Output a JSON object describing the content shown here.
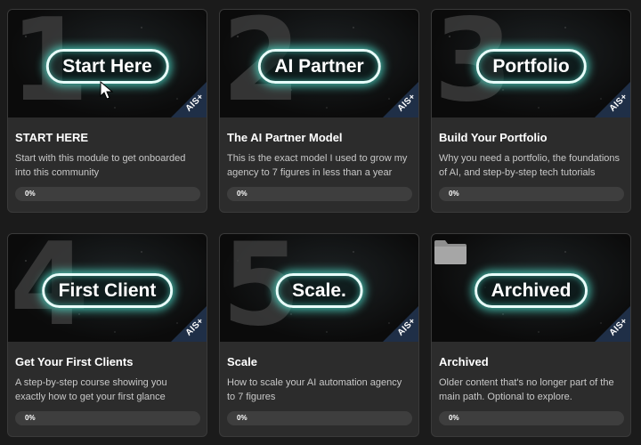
{
  "courses": [
    {
      "thumb_number": "1",
      "thumb_label": "Start Here",
      "badge": "AIS+",
      "title": "START HERE",
      "description": "Start with this module to get onboarded into this community",
      "progress_label": "0%",
      "progress": 0
    },
    {
      "thumb_number": "2",
      "thumb_label": "AI Partner",
      "badge": "AIS+",
      "title": "The AI Partner Model",
      "description": "This is the exact model I used to grow my agency to 7 figures in less than a year",
      "progress_label": "0%",
      "progress": 0
    },
    {
      "thumb_number": "3",
      "thumb_label": "Portfolio",
      "badge": "AIS+",
      "title": "Build Your Portfolio",
      "description": "Why you need a portfolio, the foundations of AI, and step-by-step tech tutorials",
      "progress_label": "0%",
      "progress": 0
    },
    {
      "thumb_number": "4",
      "thumb_label": "First Client",
      "badge": "AIS+",
      "title": "Get Your First Clients",
      "description": "A step-by-step course showing you exactly how to get your first glance",
      "progress_label": "0%",
      "progress": 0
    },
    {
      "thumb_number": "5",
      "thumb_label": "Scale.",
      "badge": "AIS+",
      "title": "Scale",
      "description": "How to scale your AI automation agency to 7 figures",
      "progress_label": "0%",
      "progress": 0
    },
    {
      "thumb_number": "",
      "thumb_label": "Archived",
      "badge": "AIS+",
      "title": "Archived",
      "description": "Older content that's no longer part of the main path. Optional to explore.",
      "progress_label": "0%",
      "progress": 0
    }
  ],
  "icons": {
    "cursor": "mouse-pointer-icon",
    "folder": "folder-icon"
  },
  "colors": {
    "background": "#1b1b1b",
    "card": "#2c2c2c",
    "glow": "#50e6d2",
    "badge": "#1f2f47"
  }
}
